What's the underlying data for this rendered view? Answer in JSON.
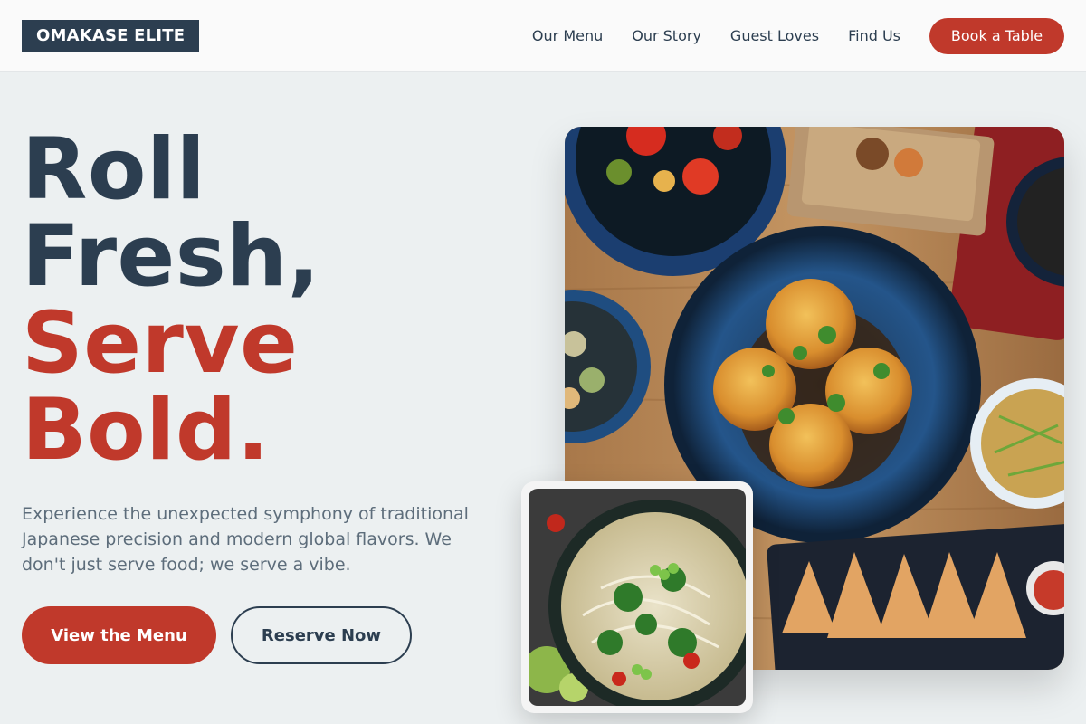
{
  "brand": {
    "logo_text": "OMAKASE ELITE"
  },
  "nav": {
    "links": [
      "Our Menu",
      "Our Story",
      "Guest Loves",
      "Find Us"
    ],
    "cta_label": "Book a Table"
  },
  "hero": {
    "title_line1": "Roll",
    "title_line2": "Fresh,",
    "title_line3": "Serve",
    "title_line4": "Bold.",
    "subtitle": "Experience the unexpected symphony of traditional Japanese precision and modern global flavors. We don't just serve food; we serve a vibe.",
    "primary_button": "View the Menu",
    "secondary_button": "Reserve Now"
  },
  "colors": {
    "navy": "#2c3e50",
    "accent_red": "#c0392b",
    "background": "#ecf0f1"
  },
  "icons": {
    "main_photo": "food-spread-photo",
    "side_photo": "noodle-bowl-photo"
  }
}
